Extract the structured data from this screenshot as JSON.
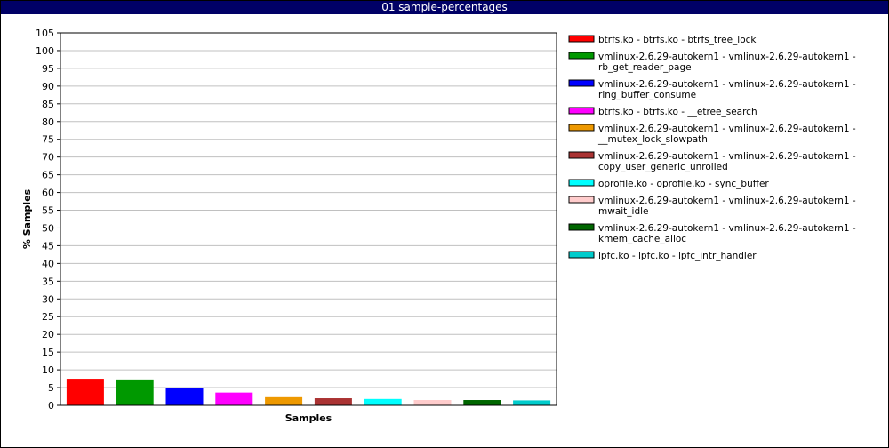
{
  "window": {
    "title": "01 sample-percentages"
  },
  "chart_data": {
    "type": "bar",
    "title": "01 sample-percentages",
    "xlabel": "Samples",
    "ylabel": "% Samples",
    "ylim": [
      0,
      105
    ],
    "yticks": [
      0,
      5,
      10,
      15,
      20,
      25,
      30,
      35,
      40,
      45,
      50,
      55,
      60,
      65,
      70,
      75,
      80,
      85,
      90,
      95,
      100,
      105
    ],
    "grid": true,
    "legend_position": "right",
    "series": [
      {
        "name": "btrfs.ko - btrfs.ko - btrfs_tree_lock",
        "value": 7.5,
        "color": "#ff0000",
        "legend_lines": [
          "btrfs.ko - btrfs.ko - btrfs_tree_lock"
        ]
      },
      {
        "name": "vmlinux-2.6.29-autokern1 - vmlinux-2.6.29-autokern1 - rb_get_reader_page",
        "value": 7.3,
        "color": "#009900",
        "legend_lines": [
          "vmlinux-2.6.29-autokern1 - vmlinux-2.6.29-autokern1 -",
          "rb_get_reader_page"
        ]
      },
      {
        "name": "vmlinux-2.6.29-autokern1 - vmlinux-2.6.29-autokern1 - ring_buffer_consume",
        "value": 5.0,
        "color": "#0000ff",
        "legend_lines": [
          "vmlinux-2.6.29-autokern1 - vmlinux-2.6.29-autokern1 -",
          "ring_buffer_consume"
        ]
      },
      {
        "name": "btrfs.ko - btrfs.ko - __etree_search",
        "value": 3.6,
        "color": "#ff00ff",
        "legend_lines": [
          "btrfs.ko - btrfs.ko - __etree_search"
        ]
      },
      {
        "name": "vmlinux-2.6.29-autokern1 - vmlinux-2.6.29-autokern1 - __mutex_lock_slowpath",
        "value": 2.3,
        "color": "#ee9900",
        "legend_lines": [
          "vmlinux-2.6.29-autokern1 - vmlinux-2.6.29-autokern1 -",
          "__mutex_lock_slowpath"
        ]
      },
      {
        "name": "vmlinux-2.6.29-autokern1 - vmlinux-2.6.29-autokern1 - copy_user_generic_unrolled",
        "value": 2.0,
        "color": "#aa3333",
        "legend_lines": [
          "vmlinux-2.6.29-autokern1 - vmlinux-2.6.29-autokern1 -",
          "copy_user_generic_unrolled"
        ]
      },
      {
        "name": "oprofile.ko - oprofile.ko - sync_buffer",
        "value": 1.8,
        "color": "#00ffff",
        "legend_lines": [
          "oprofile.ko - oprofile.ko - sync_buffer"
        ]
      },
      {
        "name": "vmlinux-2.6.29-autokern1 - vmlinux-2.6.29-autokern1 - mwait_idle",
        "value": 1.5,
        "color": "#ffcccc",
        "legend_lines": [
          "vmlinux-2.6.29-autokern1 - vmlinux-2.6.29-autokern1 -",
          "mwait_idle"
        ]
      },
      {
        "name": "vmlinux-2.6.29-autokern1 - vmlinux-2.6.29-autokern1 - kmem_cache_alloc",
        "value": 1.5,
        "color": "#006600",
        "legend_lines": [
          "vmlinux-2.6.29-autokern1 - vmlinux-2.6.29-autokern1 -",
          "kmem_cache_alloc"
        ]
      },
      {
        "name": "lpfc.ko - lpfc.ko - lpfc_intr_handler",
        "value": 1.4,
        "color": "#00cccc",
        "legend_lines": [
          "lpfc.ko - lpfc.ko - lpfc_intr_handler"
        ]
      }
    ]
  }
}
